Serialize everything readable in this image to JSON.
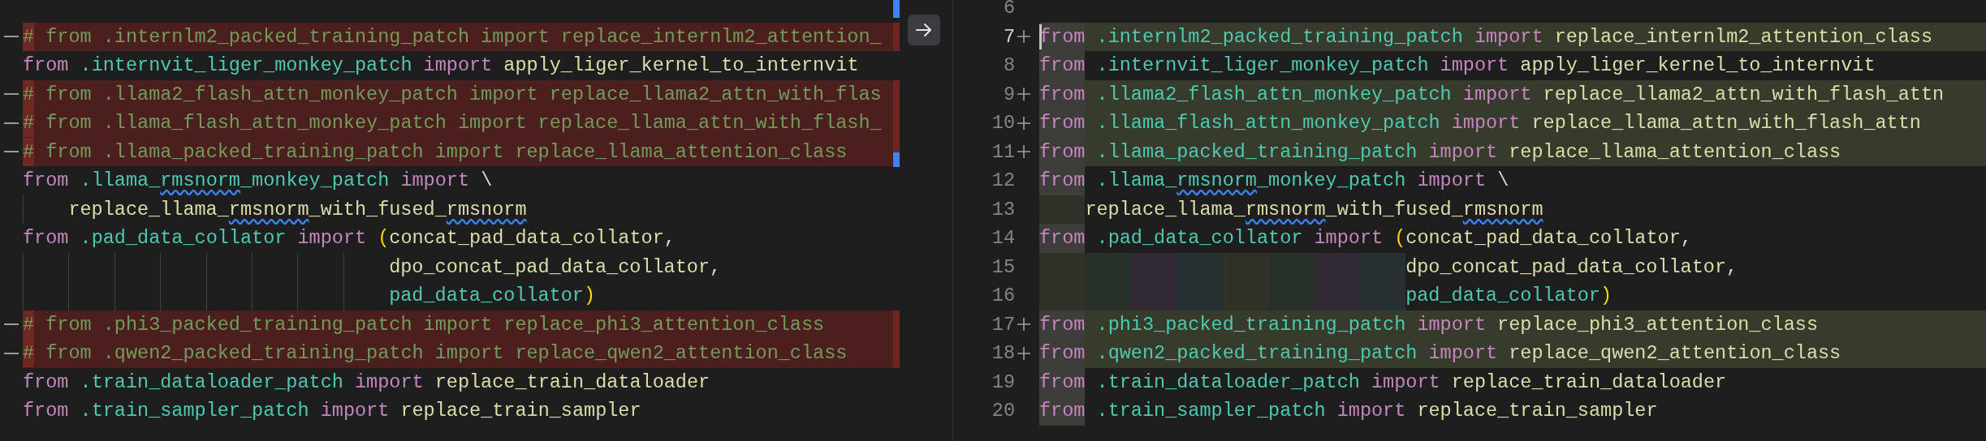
{
  "left_pane": {
    "lines": [
      {
        "kind": "blank"
      },
      {
        "kind": "deleted",
        "tokens": [
          {
            "text": "#",
            "kind": "comment_mark"
          },
          {
            "text": " from .internlm2_packed_training_patch import replace_internlm2_attention_",
            "kind": "comment"
          }
        ]
      },
      {
        "kind": "context",
        "tokens": [
          {
            "text": "from",
            "kind": "keyword"
          },
          {
            "text": " .internvit_liger_monkey_patch ",
            "kind": "module"
          },
          {
            "text": "import",
            "kind": "keyword"
          },
          {
            "text": " apply_liger_kernel_to_internvit",
            "kind": "name"
          }
        ]
      },
      {
        "kind": "deleted",
        "tokens": [
          {
            "text": "#",
            "kind": "comment_mark"
          },
          {
            "text": " from .llama2_flash_attn_monkey_patch import replace_llama2_attn_with_flas",
            "kind": "comment"
          }
        ]
      },
      {
        "kind": "deleted",
        "tokens": [
          {
            "text": "#",
            "kind": "comment_mark"
          },
          {
            "text": " from .llama_flash_attn_monkey_patch import replace_llama_attn_with_flash_",
            "kind": "comment"
          }
        ]
      },
      {
        "kind": "deleted",
        "tokens": [
          {
            "text": "#",
            "kind": "comment_mark"
          },
          {
            "text": " from .llama_packed_training_patch import replace_llama_attention_class",
            "kind": "comment"
          }
        ]
      },
      {
        "kind": "context",
        "tokens": [
          {
            "text": "from",
            "kind": "keyword"
          },
          {
            "text": " .llama_",
            "kind": "module"
          },
          {
            "text": "rmsnorm",
            "kind": "module_warn"
          },
          {
            "text": "_monkey_patch ",
            "kind": "module"
          },
          {
            "text": "import",
            "kind": "keyword"
          },
          {
            "text": " \\",
            "kind": "punct"
          }
        ]
      },
      {
        "kind": "context",
        "tokens": [
          {
            "kind": "indent_continuation"
          },
          {
            "text": "replace_llama_",
            "kind": "name"
          },
          {
            "text": "rmsnorm",
            "kind": "name_warn"
          },
          {
            "text": "_with_fused_",
            "kind": "name"
          },
          {
            "text": "rmsnorm",
            "kind": "name_warn"
          }
        ]
      },
      {
        "kind": "context",
        "tokens": [
          {
            "text": "from",
            "kind": "keyword"
          },
          {
            "text": " .pad_data_collator ",
            "kind": "module"
          },
          {
            "text": "import",
            "kind": "keyword"
          },
          {
            "text": " (",
            "kind": "paren"
          },
          {
            "text": "concat_pad_data_collator",
            "kind": "name"
          },
          {
            "text": ",",
            "kind": "punct"
          }
        ]
      },
      {
        "kind": "context",
        "tokens": [
          {
            "kind": "indent_align"
          },
          {
            "text": "dpo_concat_pad_data_collator",
            "kind": "name"
          },
          {
            "text": ",",
            "kind": "punct"
          }
        ]
      },
      {
        "kind": "context",
        "tokens": [
          {
            "kind": "indent_align"
          },
          {
            "text": "pad_data_collator",
            "kind": "module"
          },
          {
            "text": ")",
            "kind": "paren"
          }
        ]
      },
      {
        "kind": "deleted",
        "tokens": [
          {
            "text": "#",
            "kind": "comment_mark"
          },
          {
            "text": " from .phi3_packed_training_patch import replace_phi3_attention_class",
            "kind": "comment"
          }
        ]
      },
      {
        "kind": "deleted",
        "tokens": [
          {
            "text": "#",
            "kind": "comment_mark"
          },
          {
            "text": " from .qwen2_packed_training_patch import replace_qwen2_attention_class",
            "kind": "comment"
          }
        ]
      },
      {
        "kind": "context",
        "tokens": [
          {
            "text": "from",
            "kind": "keyword"
          },
          {
            "text": " .train_dataloader_patch ",
            "kind": "module"
          },
          {
            "text": "import",
            "kind": "keyword"
          },
          {
            "text": " replace_train_dataloader",
            "kind": "name"
          }
        ]
      },
      {
        "kind": "context",
        "tokens": [
          {
            "text": "from",
            "kind": "keyword"
          },
          {
            "text": " .train_sampler_patch ",
            "kind": "module"
          },
          {
            "text": "import",
            "kind": "keyword"
          },
          {
            "text": " replace_train_sampler",
            "kind": "name"
          }
        ]
      }
    ]
  },
  "right_pane": {
    "lines": [
      {
        "number": "6",
        "kind": "context",
        "current": false
      },
      {
        "number": "7",
        "kind": "added",
        "current": true,
        "tokens": [
          {
            "text": "from",
            "kind": "keyword"
          },
          {
            "text": " .internlm2_packed_training_patch ",
            "kind": "module"
          },
          {
            "text": "import",
            "kind": "keyword"
          },
          {
            "text": " replace_internlm2_attention_class",
            "kind": "name"
          }
        ]
      },
      {
        "number": "8",
        "kind": "context",
        "current": false,
        "tokens": [
          {
            "text": "from",
            "kind": "keyword"
          },
          {
            "text": " .internvit_liger_monkey_patch ",
            "kind": "module"
          },
          {
            "text": "import",
            "kind": "keyword"
          },
          {
            "text": " apply_liger_kernel_to_internvit",
            "kind": "name"
          }
        ]
      },
      {
        "number": "9",
        "kind": "added",
        "current": false,
        "tokens": [
          {
            "text": "from",
            "kind": "keyword"
          },
          {
            "text": " .llama2_flash_attn_monkey_patch ",
            "kind": "module"
          },
          {
            "text": "import",
            "kind": "keyword"
          },
          {
            "text": " replace_llama2_attn_with_flash_attn",
            "kind": "name"
          }
        ]
      },
      {
        "number": "10",
        "kind": "added",
        "current": false,
        "tokens": [
          {
            "text": "from",
            "kind": "keyword"
          },
          {
            "text": " .llama_flash_attn_monkey_patch ",
            "kind": "module"
          },
          {
            "text": "import",
            "kind": "keyword"
          },
          {
            "text": " replace_llama_attn_with_flash_attn",
            "kind": "name"
          }
        ]
      },
      {
        "number": "11",
        "kind": "added",
        "current": false,
        "tokens": [
          {
            "text": "from",
            "kind": "keyword"
          },
          {
            "text": " .llama_packed_training_patch ",
            "kind": "module"
          },
          {
            "text": "import",
            "kind": "keyword"
          },
          {
            "text": " replace_llama_attention_class",
            "kind": "name"
          }
        ]
      },
      {
        "number": "12",
        "kind": "context",
        "current": false,
        "tokens": [
          {
            "text": "from",
            "kind": "keyword"
          },
          {
            "text": " .llama_",
            "kind": "module"
          },
          {
            "text": "rmsnorm",
            "kind": "module_warn"
          },
          {
            "text": "_monkey_patch ",
            "kind": "module"
          },
          {
            "text": "import",
            "kind": "keyword"
          },
          {
            "text": " \\",
            "kind": "punct"
          }
        ]
      },
      {
        "number": "13",
        "kind": "context",
        "current": false,
        "tokens": [
          {
            "kind": "indent_continuation"
          },
          {
            "text": "replace_llama_",
            "kind": "name"
          },
          {
            "text": "rmsnorm",
            "kind": "name_warn"
          },
          {
            "text": "_with_fused_",
            "kind": "name"
          },
          {
            "text": "rmsnorm",
            "kind": "name_warn"
          }
        ]
      },
      {
        "number": "14",
        "kind": "context",
        "current": false,
        "tokens": [
          {
            "text": "from",
            "kind": "keyword"
          },
          {
            "text": " .pad_data_collator ",
            "kind": "module"
          },
          {
            "text": "import",
            "kind": "keyword"
          },
          {
            "text": " (",
            "kind": "paren"
          },
          {
            "text": "concat_pad_data_collator",
            "kind": "name"
          },
          {
            "text": ",",
            "kind": "punct"
          }
        ]
      },
      {
        "number": "15",
        "kind": "context",
        "current": false,
        "tokens": [
          {
            "kind": "indent_align"
          },
          {
            "text": "dpo_concat_pad_data_collator",
            "kind": "name"
          },
          {
            "text": ",",
            "kind": "punct"
          }
        ]
      },
      {
        "number": "16",
        "kind": "context",
        "current": false,
        "tokens": [
          {
            "kind": "indent_align"
          },
          {
            "text": "pad_data_collator",
            "kind": "module"
          },
          {
            "text": ")",
            "kind": "paren"
          }
        ]
      },
      {
        "number": "17",
        "kind": "added",
        "current": false,
        "tokens": [
          {
            "text": "from",
            "kind": "keyword"
          },
          {
            "text": " .phi3_packed_training_patch ",
            "kind": "module"
          },
          {
            "text": "import",
            "kind": "keyword"
          },
          {
            "text": " replace_phi3_attention_class",
            "kind": "name"
          }
        ]
      },
      {
        "number": "18",
        "kind": "added",
        "current": false,
        "tokens": [
          {
            "text": "from",
            "kind": "keyword"
          },
          {
            "text": " .qwen2_packed_training_patch ",
            "kind": "module"
          },
          {
            "text": "import",
            "kind": "keyword"
          },
          {
            "text": " replace_qwen2_attention_class",
            "kind": "name"
          }
        ]
      },
      {
        "number": "19",
        "kind": "context",
        "current": false,
        "tokens": [
          {
            "text": "from",
            "kind": "keyword"
          },
          {
            "text": " .train_dataloader_patch ",
            "kind": "module"
          },
          {
            "text": "import",
            "kind": "keyword"
          },
          {
            "text": " replace_train_dataloader",
            "kind": "name"
          }
        ]
      },
      {
        "number": "20",
        "kind": "context",
        "current": false,
        "tokens": [
          {
            "text": "from",
            "kind": "keyword"
          },
          {
            "text": " .train_sampler_patch ",
            "kind": "module"
          },
          {
            "text": "import",
            "kind": "keyword"
          },
          {
            "text": " replace_train_sampler",
            "kind": "name"
          }
        ]
      }
    ]
  }
}
